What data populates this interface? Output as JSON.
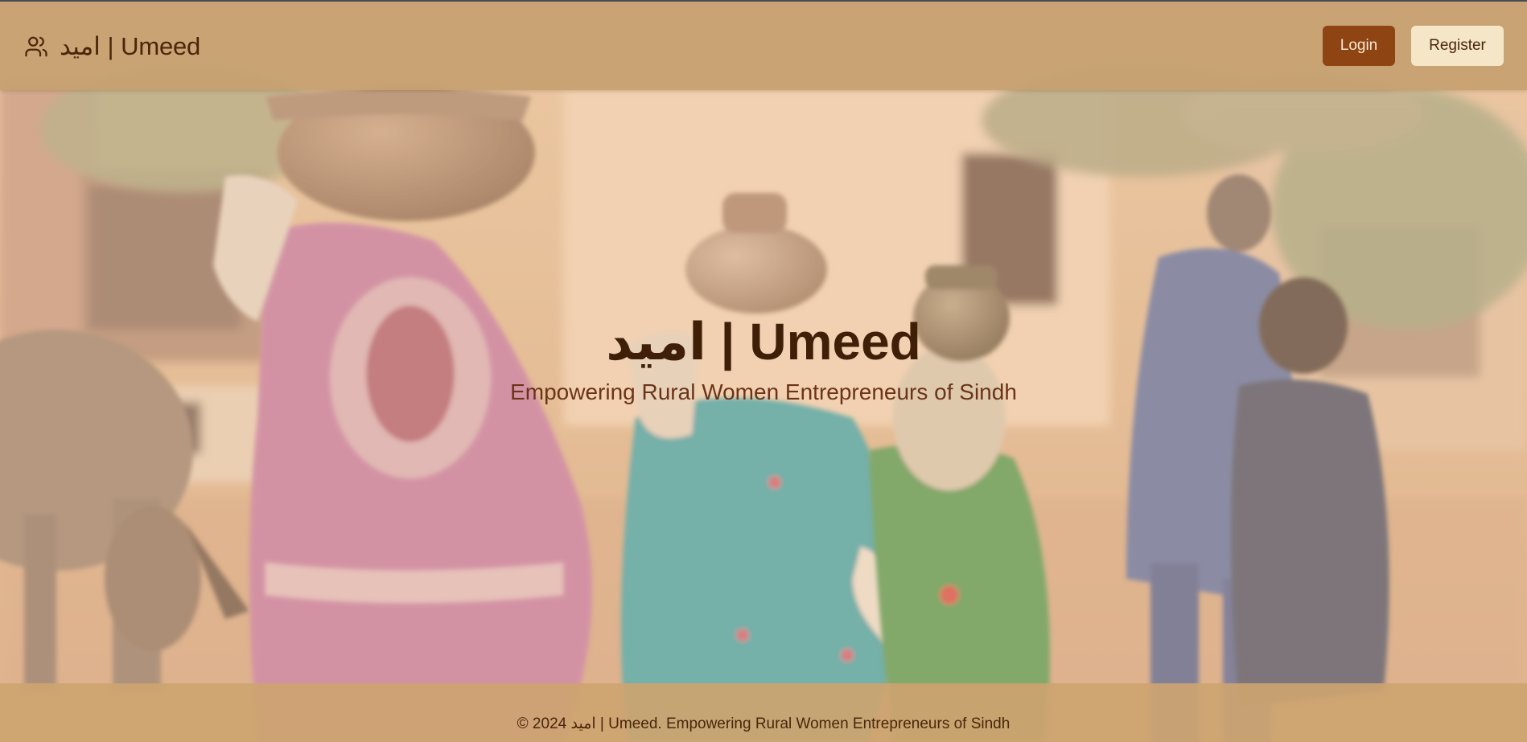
{
  "header": {
    "brand": "امید | Umeed",
    "brand_icon": "users-icon",
    "login_label": "Login",
    "register_label": "Register"
  },
  "hero": {
    "title": "امید | Umeed",
    "subtitle": "Empowering Rural Women Entrepreneurs of Sindh",
    "background": "photo of rural women in Sindh carrying water pots, warm overlay"
  },
  "footer": {
    "text": "© 2024 امید | Umeed. Empowering Rural Women Entrepreneurs of Sindh"
  },
  "colors": {
    "header_bg": "#c6a070",
    "login_bg": "#8f4413",
    "register_bg": "#f4e6c6",
    "title_text": "#3f1f08",
    "subtitle_text": "#6b3418"
  }
}
